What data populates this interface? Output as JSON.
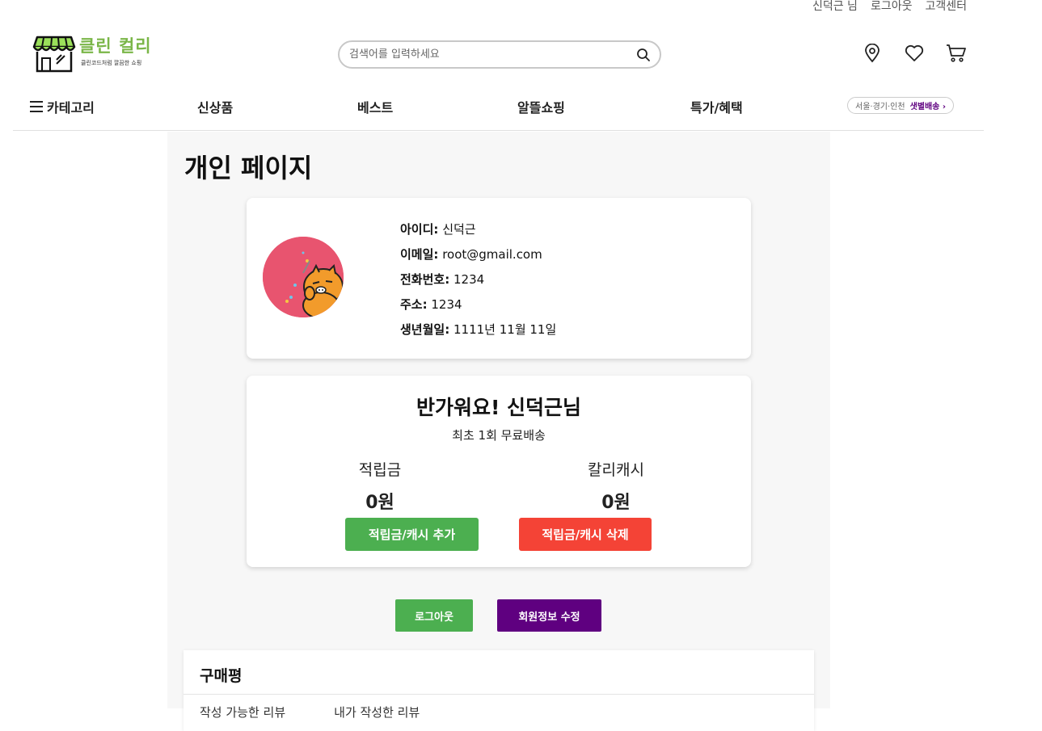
{
  "util_bar": {
    "user": "신덕근 님",
    "logout": "로그아웃",
    "support": "고객센터"
  },
  "logo": {
    "title": "클린 컬리",
    "subtitle": "클린코드처럼 깔끔한 쇼핑"
  },
  "search": {
    "placeholder": "검색어를 입력하세요",
    "value": ""
  },
  "nav": {
    "category": "카테고리",
    "items": [
      "신상품",
      "베스트",
      "알뜰쇼핑",
      "특가/혜택"
    ],
    "delivery_region": "서울·경기·인천",
    "delivery_label": "샛별배송 ›"
  },
  "page": {
    "title": "개인 페이지"
  },
  "profile": {
    "id_label": "아이디:",
    "id": "신덕근",
    "email_label": "이메일:",
    "email": "root@gmail.com",
    "phone_label": "전화번호:",
    "phone": "1234",
    "address_label": "주소:",
    "address": "1234",
    "birth_label": "생년월일:",
    "birth": "1111년 11월 11일"
  },
  "cash": {
    "greeting": "반가워요! 신덕근님",
    "benefit": "최초 1회 무료배송",
    "points_label": "적립금",
    "points_value": "0원",
    "kurly_cash_label": "칼리캐시",
    "kurly_cash_value": "0원",
    "add_button": "적립금/캐시 추가",
    "delete_button": "적립금/캐시 삭제"
  },
  "actions": {
    "logout": "로그아웃",
    "edit": "회원정보 수정"
  },
  "review": {
    "title": "구매평",
    "tabs": [
      "작성 가능한 리뷰",
      "내가 작성한 리뷰"
    ]
  },
  "colors": {
    "brand_green": "#7ab648",
    "purple": "#5f0080",
    "green_button": "#4caf50",
    "red_button": "#f44336"
  }
}
